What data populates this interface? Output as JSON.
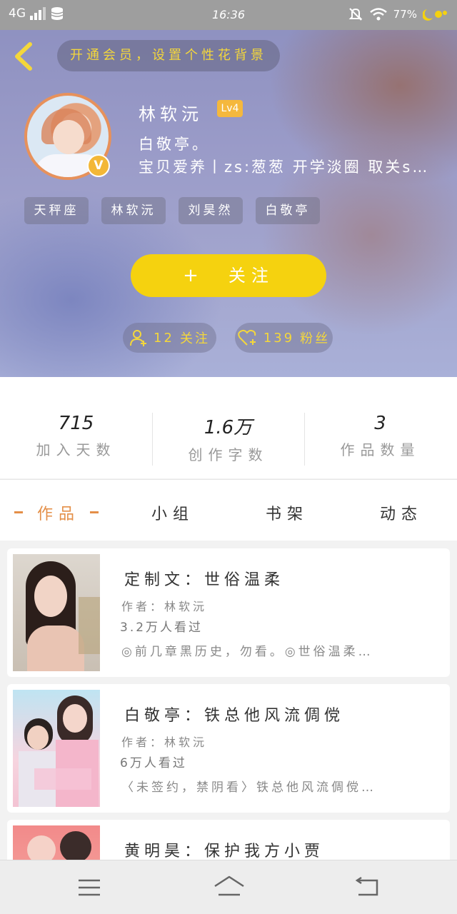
{
  "status_bar": {
    "network": "4G",
    "time": "16:36",
    "battery": "77%"
  },
  "header": {
    "notice": "开通会员，设置个性花背景",
    "name": "林软沅",
    "level": "Lv4",
    "verified_badge": "V",
    "bio_line1": "白敬亭。",
    "bio_line2": "宝贝爱养丨zs:葱葱 开学淡圈 取关s…",
    "tags": [
      "天秤座",
      "林软沅",
      "刘昊然",
      "白敬亭"
    ],
    "follow_label": "关注",
    "follow_plus": "+",
    "following_count": "12",
    "following_label": "关注",
    "fans_count": "139",
    "fans_label": "粉丝"
  },
  "stats": [
    {
      "value": "715",
      "label": "加入天数"
    },
    {
      "value": "1.6万",
      "label": "创作字数"
    },
    {
      "value": "3",
      "label": "作品数量"
    }
  ],
  "tabs": [
    {
      "label": "作品",
      "active": true
    },
    {
      "label": "小组",
      "active": false
    },
    {
      "label": "书架",
      "active": false
    },
    {
      "label": "动态",
      "active": false
    }
  ],
  "works": [
    {
      "title": "定制文：世俗温柔",
      "author": "作者：林软沅",
      "views": "3.2万人看过",
      "desc": "◎前几章黑历史，勿看。◎世俗温柔…"
    },
    {
      "title": "白敬亭：铁总他风流倜傥",
      "author": "作者：林软沅",
      "views": "6万人看过",
      "desc": "〈未签约，禁阴看〉铁总他风流倜傥…"
    },
    {
      "title": "黄明昊：保护我方小贾",
      "author": "",
      "views": "",
      "desc": ""
    }
  ],
  "colors": {
    "accent": "#e48f48",
    "follow": "#f5d20f",
    "notice_text": "#f4d73b"
  },
  "icons": [
    "signal-icon",
    "database-icon",
    "mute-icon",
    "wifi-icon",
    "battery-icon",
    "back-icon",
    "user-plus-icon",
    "heart-plus-icon",
    "menu-icon",
    "home-icon",
    "return-icon"
  ]
}
